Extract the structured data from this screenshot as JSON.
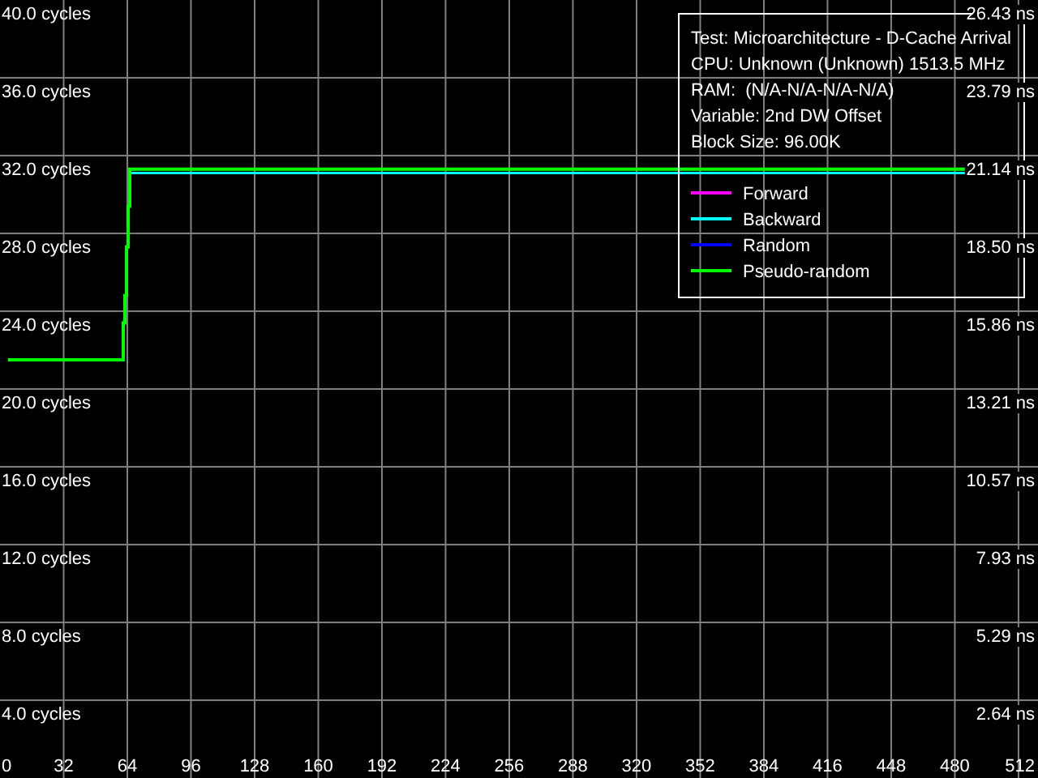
{
  "chart_data": {
    "type": "line",
    "x": [
      4,
      62,
      62,
      62.8,
      62.8,
      63.6,
      63.6,
      64.4,
      64.4,
      65.2,
      65.2,
      485
    ],
    "series": [
      {
        "name": "Forward",
        "color": "#ff00ff",
        "values": [
          null,
          null,
          null,
          null,
          null,
          null,
          null,
          null,
          null,
          null,
          null,
          null
        ]
      },
      {
        "name": "Backward",
        "color": "#00ffff",
        "values": [
          null,
          null,
          null,
          null,
          null,
          null,
          null,
          null,
          null,
          null,
          31.1,
          31.1
        ]
      },
      {
        "name": "Random",
        "color": "#0000ff",
        "values": [
          null,
          null,
          null,
          null,
          null,
          null,
          null,
          null,
          null,
          null,
          null,
          null
        ]
      },
      {
        "name": "Pseudo-random",
        "color": "#00ff00",
        "values": [
          21.5,
          21.5,
          23.4,
          23.4,
          24.8,
          24.8,
          27.3,
          27.3,
          29.4,
          29.4,
          31.3,
          31.3
        ]
      }
    ],
    "xlim": [
      0,
      521.8
    ],
    "ylim": [
      0,
      40
    ],
    "xticks": [
      0,
      32,
      64,
      96,
      128,
      160,
      192,
      224,
      256,
      288,
      320,
      352,
      384,
      416,
      448,
      480,
      512
    ],
    "yticks": [
      {
        "value": 40,
        "label": "40.0 cycles"
      },
      {
        "value": 36,
        "label": "36.0 cycles"
      },
      {
        "value": 32,
        "label": "32.0 cycles"
      },
      {
        "value": 28,
        "label": "28.0 cycles"
      },
      {
        "value": 24,
        "label": "24.0 cycles"
      },
      {
        "value": 20,
        "label": "20.0 cycles"
      },
      {
        "value": 16,
        "label": "16.0 cycles"
      },
      {
        "value": 12,
        "label": "12.0 cycles"
      },
      {
        "value": 8,
        "label": "8.0 cycles"
      },
      {
        "value": 4,
        "label": "4.0 cycles"
      }
    ],
    "grid": true,
    "legend": true
  },
  "right_axis_labels": [
    "26.43 ns",
    "23.79 ns",
    "21.14 ns",
    "18.50 ns",
    "15.86 ns",
    "13.21 ns",
    "10.57 ns",
    "7.93 ns",
    "5.29 ns",
    "2.64 ns"
  ],
  "info": [
    "Test: Microarchitecture - D-Cache Arrival",
    "CPU: Unknown (Unknown) 1513.5 MHz",
    "RAM:  (N/A-N/A-N/A-N/A)",
    "Variable: 2nd DW Offset",
    "Block Size: 96.00K"
  ]
}
